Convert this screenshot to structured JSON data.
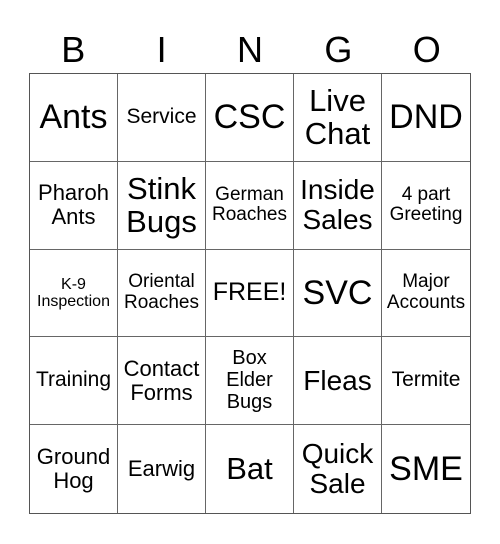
{
  "header": [
    "B",
    "I",
    "N",
    "G",
    "O"
  ],
  "cells": [
    [
      "Ants",
      "Service",
      "CSC",
      "Live Chat",
      "DND"
    ],
    [
      "Pharoh Ants",
      "Stink Bugs",
      "German Roaches",
      "Inside Sales",
      "4 part Greeting"
    ],
    [
      "K-9 Inspection",
      "Oriental Roaches",
      "FREE!",
      "SVC",
      "Major Accounts"
    ],
    [
      "Training",
      "Contact Forms",
      "Box Elder Bugs",
      "Fleas",
      "Termite"
    ],
    [
      "Ground Hog",
      "Earwig",
      "Bat",
      "Quick Sale",
      "SME"
    ]
  ]
}
